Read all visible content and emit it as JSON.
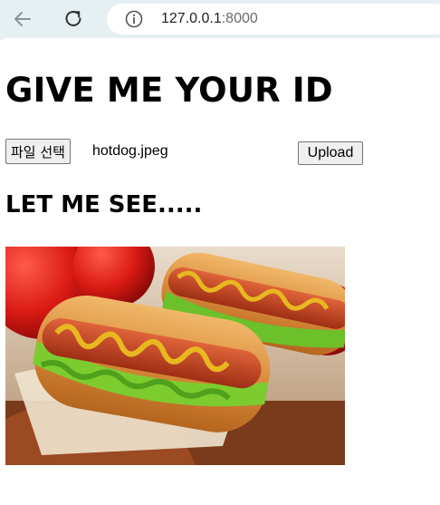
{
  "browser": {
    "url_host": "127.0.0.1",
    "url_port": ":8000",
    "icons": [
      "back-arrow-icon",
      "reload-icon",
      "info-icon"
    ]
  },
  "page": {
    "heading": "GIVE ME YOUR ID",
    "file_button_label": "파일 선택",
    "file_name": "hotdog.jpeg",
    "upload_label": "Upload",
    "subheading": "LET ME SEE.....",
    "image_subject": "two hot dogs with mustard and lettuce"
  },
  "colors": {
    "toolbar_bg": "#e6f0f2",
    "address_bg": "#ffffff",
    "button_bg": "#efefef"
  }
}
